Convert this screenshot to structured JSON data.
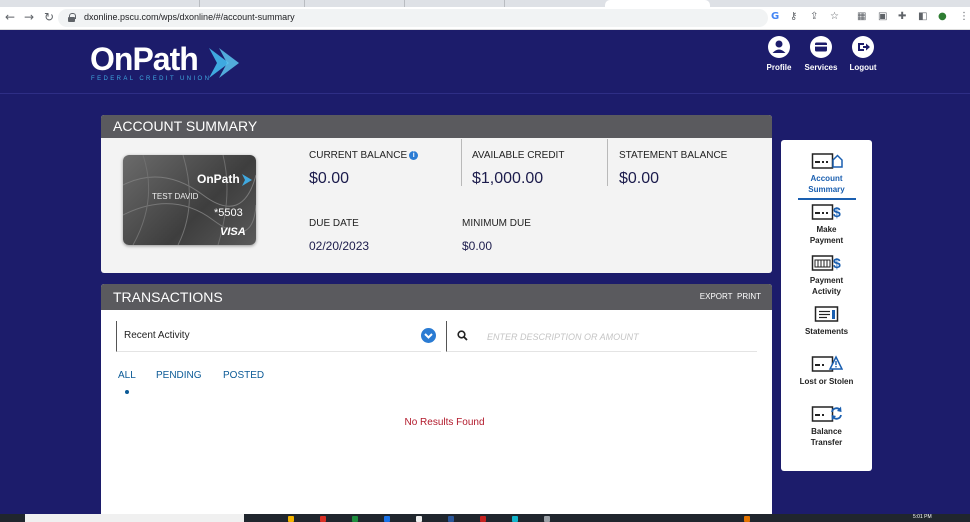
{
  "browser": {
    "url": "dxonline.pscu.com/wps/dxonline/#/account-summary",
    "nav_icons": [
      "back-icon",
      "forward-icon",
      "reload-icon"
    ],
    "extension_icons": [
      "google-icon",
      "key-icon",
      "share-icon",
      "star-icon",
      "extension-icon",
      "puzzle-icon",
      "sidebar-icon",
      "profile-icon",
      "menu-icon"
    ]
  },
  "header": {
    "logo_text": "OnPath",
    "logo_subtext": "FEDERAL CREDIT UNION",
    "buttons": [
      {
        "label": "Profile",
        "icon": "user-icon"
      },
      {
        "label": "Services",
        "icon": "card-icon"
      },
      {
        "label": "Logout",
        "icon": "logout-icon"
      }
    ]
  },
  "account_summary": {
    "title": "ACCOUNT SUMMARY",
    "card": {
      "brand": "OnPath",
      "holder": "TEST DAVID",
      "number": "*5503",
      "network": "VISA"
    },
    "current_balance": {
      "label": "CURRENT BALANCE",
      "value": "$0.00"
    },
    "available_credit": {
      "label": "AVAILABLE CREDIT",
      "value": "$1,000.00"
    },
    "statement_balance": {
      "label": "STATEMENT BALANCE",
      "value": "$0.00"
    },
    "due_date": {
      "label": "DUE DATE",
      "value": "02/20/2023"
    },
    "minimum_due": {
      "label": "MINIMUM DUE",
      "value": "$0.00"
    }
  },
  "transactions": {
    "title": "TRANSACTIONS",
    "export_label": "EXPORT",
    "print_label": "PRINT",
    "filter_value": "Recent Activity",
    "search_placeholder": "ENTER DESCRIPTION OR AMOUNT",
    "tabs": [
      "ALL",
      "PENDING",
      "POSTED"
    ],
    "active_tab": "ALL",
    "empty_message": "No Results Found"
  },
  "sidebar": {
    "items": [
      {
        "line1": "Account",
        "line2": "Summary",
        "icon": "account-summary-icon",
        "active": true
      },
      {
        "line1": "Make",
        "line2": "Payment",
        "icon": "make-payment-icon",
        "active": false
      },
      {
        "line1": "Payment",
        "line2": "Activity",
        "icon": "payment-activity-icon",
        "active": false
      },
      {
        "line1": "Statements",
        "line2": "",
        "icon": "statements-icon",
        "active": false
      },
      {
        "line1": "Lost or Stolen",
        "line2": "",
        "icon": "lost-stolen-icon",
        "active": false
      },
      {
        "line1": "Balance",
        "line2": "Transfer",
        "icon": "balance-transfer-icon",
        "active": false
      }
    ]
  },
  "colors": {
    "page_bg": "#1c1c6b",
    "panel_header": "#5a5a5e",
    "accent_blue": "#2a7bd3",
    "link_blue": "#0b5a96",
    "error_red": "#b2192b",
    "logo_cyan": "#3fa9e0"
  },
  "taskbar": {
    "clock": "5:01 PM"
  }
}
